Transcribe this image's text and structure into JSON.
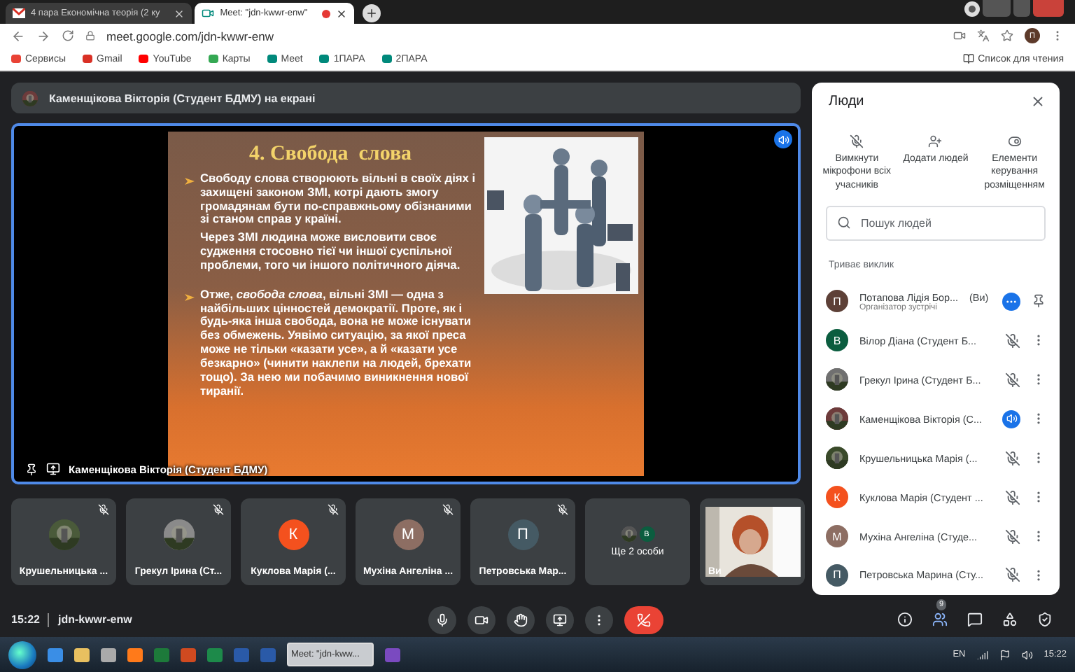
{
  "browser": {
    "tabs": [
      {
        "title": "4 пара Економічна теорія (2 ку",
        "kind": "mail",
        "selected": false,
        "recording": false
      },
      {
        "title": "Meet: \"jdn-kwwr-enw\"",
        "kind": "meet",
        "selected": true,
        "recording": true
      }
    ],
    "address": "meet.google.com/jdn-kwwr-enw",
    "profile": "П",
    "bookmarks": [
      {
        "label": "Сервисы",
        "color": "#e94235"
      },
      {
        "label": "Gmail",
        "color": "#d93025"
      },
      {
        "label": "YouTube",
        "color": "#ff0000"
      },
      {
        "label": "Карты",
        "color": "#34a853"
      },
      {
        "label": "Meet",
        "color": "#00897b"
      },
      {
        "label": "1ПАРА",
        "color": "#00897b"
      },
      {
        "label": "2ПАРА",
        "color": "#00897b"
      }
    ],
    "reading_list": "Список для чтения"
  },
  "presenting_banner": "Каменщікова Вікторія (Студент БДМУ) на екрані",
  "stage": {
    "presenter": "Каменщікова Вікторія (Студент БДМУ)",
    "speaking": true,
    "slide": {
      "title": "4. Свобода  слова",
      "paragraphs": [
        {
          "bullet": true,
          "text": "Свободу слова створюють вільні в своїх діях і захищені законом ЗМІ, котрі дають змогу громадянам бути по-справжньому обізнаними зі станом справ у країні."
        },
        {
          "bullet": false,
          "text": "Через ЗМІ людина може висловити своє судження стосовно тієї чи іншої суспільної проблеми, того чи іншого політичного діяча."
        },
        {
          "bullet": true,
          "text": "Отже, *свобода слова*, вільні ЗМІ — одна з найбільших цінностей демократії. Проте, як і будь-яка інша свобода, вона не може існувати без обмежень. Уявімо ситуацію, за якої преса може не тільки «казати усе», а й «казати усе безкарно» (чинити наклепи на людей, брехати тощо). За нею ми побачимо виникнення нової тиранії."
        }
      ]
    }
  },
  "tiles": [
    {
      "name": "Крушельницька ...",
      "muted": true,
      "color": "#4a5a3a"
    },
    {
      "name": "Грекул Ірина (Ст...",
      "muted": true,
      "color": "#8a8a8a"
    },
    {
      "kind": "letter",
      "letter": "К",
      "name": "Куклова Марія (...",
      "muted": true,
      "color": "#f4511e"
    },
    {
      "kind": "letter",
      "letter": "М",
      "name": "Мухіна Ангеліна ...",
      "muted": true,
      "color": "#8d6e63"
    },
    {
      "kind": "letter",
      "letter": "П",
      "name": "Петровська Мар...",
      "muted": true,
      "color": "#455a64"
    },
    {
      "kind": "more",
      "letter": "В",
      "name": "Ще 2 особи",
      "muted": false,
      "color": "#0b5d3f"
    },
    {
      "kind": "self",
      "name": "Ви",
      "muted": false,
      "color": "#b5502a"
    }
  ],
  "people_panel": {
    "title": "Люди",
    "actions": [
      "Вимкнути мікрофони всіх учасників",
      "Додати людей",
      "Елементи керування розміщенням"
    ],
    "search": {
      "placeholder": "Пошук людей"
    },
    "section": "Триває виклик",
    "participants": [
      {
        "kind": "host",
        "letter": "П",
        "color": "#5d4037",
        "name": "Потапова Лідія Бор...",
        "you": "(Ви)",
        "role": "Організатор зустрічі",
        "muted": false,
        "speaking": false
      },
      {
        "kind": "member",
        "letter": "В",
        "color": "#0b5d3f",
        "name": "Вілор Діана (Студент Б...",
        "muted": true,
        "speaking": false
      },
      {
        "kind": "member",
        "photo": true,
        "color": "#707070",
        "name": "Грекул Ірина (Студент Б...",
        "muted": true,
        "speaking": false
      },
      {
        "kind": "member",
        "photo": true,
        "color": "#6d3b3b",
        "name": "Каменщікова Вікторія (С...",
        "muted": false,
        "speaking": true
      },
      {
        "kind": "member",
        "photo": true,
        "color": "#3a4a2a",
        "name": "Крушельницька Марія (...",
        "muted": true,
        "speaking": false
      },
      {
        "kind": "member",
        "letter": "К",
        "color": "#f4511e",
        "name": "Куклова Марія (Студент ...",
        "muted": true,
        "speaking": false
      },
      {
        "kind": "member",
        "letter": "М",
        "color": "#8d6e63",
        "name": "Мухіна Ангеліна (Студе...",
        "muted": true,
        "speaking": false
      },
      {
        "kind": "member",
        "letter": "П",
        "color": "#455a64",
        "name": "Петровська Марина (Сту...",
        "muted": true,
        "speaking": false
      }
    ]
  },
  "bottom_bar": {
    "time": "15:22",
    "code": "jdn-kwwr-enw",
    "mic_on": true,
    "people_count": "9"
  },
  "taskbar": {
    "window": "Meet: \"jdn-kww...",
    "language": "EN",
    "clock": "15:22"
  }
}
